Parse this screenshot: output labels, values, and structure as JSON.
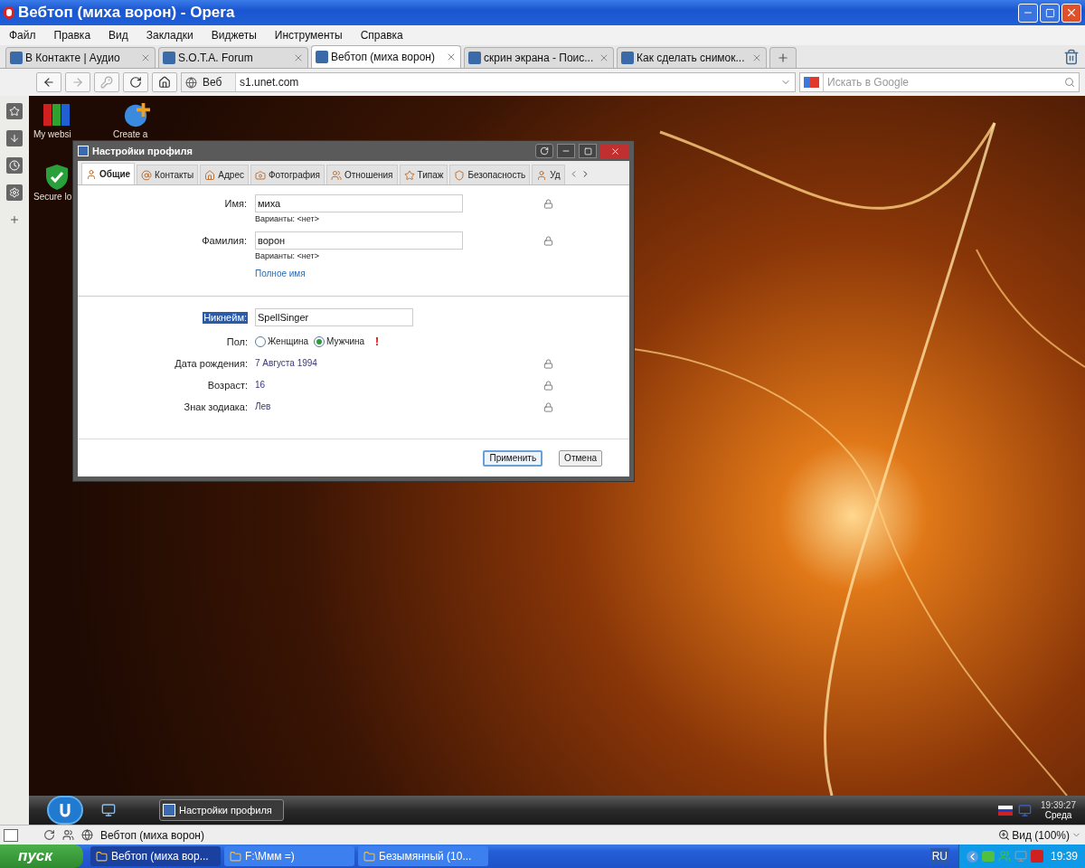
{
  "window": {
    "title": "Вебтоп (миха ворон) - Opera"
  },
  "menu": [
    "Файл",
    "Правка",
    "Вид",
    "Закладки",
    "Виджеты",
    "Инструменты",
    "Справка"
  ],
  "tabs": [
    {
      "label": "В Контакте | Аудио",
      "selected": false
    },
    {
      "label": "S.O.T.A. Forum",
      "selected": false
    },
    {
      "label": "Вебтоп (миха ворон)",
      "selected": true
    },
    {
      "label": "скрин экрана - Поис...",
      "selected": false
    },
    {
      "label": "Как сделать снимок...",
      "selected": false
    }
  ],
  "address_bar": {
    "scope": "Веб",
    "url": "s1.unet.com"
  },
  "search": {
    "placeholder": "Искать в Google"
  },
  "desktop_icons": [
    {
      "label": "My websi",
      "kind": "folders"
    },
    {
      "label": "Create a",
      "kind": "globe"
    },
    {
      "label": "Secure lo",
      "kind": "shield"
    }
  ],
  "dialog": {
    "title": "Настройки профиля",
    "tabs": [
      {
        "label": "Общие",
        "selected": true
      },
      {
        "label": "Контакты",
        "selected": false
      },
      {
        "label": "Адрес",
        "selected": false
      },
      {
        "label": "Фотография",
        "selected": false
      },
      {
        "label": "Отношения",
        "selected": false
      },
      {
        "label": "Типаж",
        "selected": false
      },
      {
        "label": "Безопасность",
        "selected": false
      },
      {
        "label": "Уд",
        "selected": false
      }
    ],
    "sections": [
      {
        "rows": [
          {
            "kind": "input",
            "label": "Имя:",
            "highlighted": false,
            "value": "миха",
            "hint": "Варианты: <нет>",
            "locked": true
          },
          {
            "kind": "input",
            "label": "Фамилия:",
            "highlighted": false,
            "value": "ворон",
            "hint": "Варианты: <нет>",
            "locked": true
          },
          {
            "kind": "link",
            "text": "Полное имя"
          }
        ]
      },
      {
        "rows": [
          {
            "kind": "input",
            "label": "Никнейм:",
            "highlighted": true,
            "value": "SpellSinger",
            "locked": false
          },
          {
            "kind": "radio",
            "label": "Пол:",
            "options": [
              {
                "label": "Женщина",
                "selected": false
              },
              {
                "label": "Мужчина",
                "selected": true
              }
            ],
            "warning": "!"
          },
          {
            "kind": "value",
            "label": "Дата рождения:",
            "value": "7 Августа 1994",
            "locked": true
          },
          {
            "kind": "value",
            "label": "Возраст:",
            "value": "16",
            "locked": true
          },
          {
            "kind": "value",
            "label": "Знак зодиака:",
            "value": "Лев",
            "locked": true
          }
        ]
      }
    ],
    "buttons": [
      {
        "label": "Применить",
        "selected": true
      },
      {
        "label": "Отмена",
        "selected": false
      }
    ]
  },
  "webtop_taskbar": {
    "task": "Настройки профиля",
    "time": "19:39:27",
    "day": "Среда"
  },
  "status_bar": {
    "page": "Вебтоп (миха ворон)",
    "zoom": "Вид (100%)"
  },
  "taskbar": {
    "start": "пуск",
    "tasks": [
      {
        "label": "Вебтоп (миха вор...",
        "selected": true
      },
      {
        "label": "F:\\Ммм =)",
        "selected": false
      },
      {
        "label": "Безымянный (10...",
        "selected": false
      }
    ],
    "lang": "RU",
    "clock": "19:39"
  }
}
